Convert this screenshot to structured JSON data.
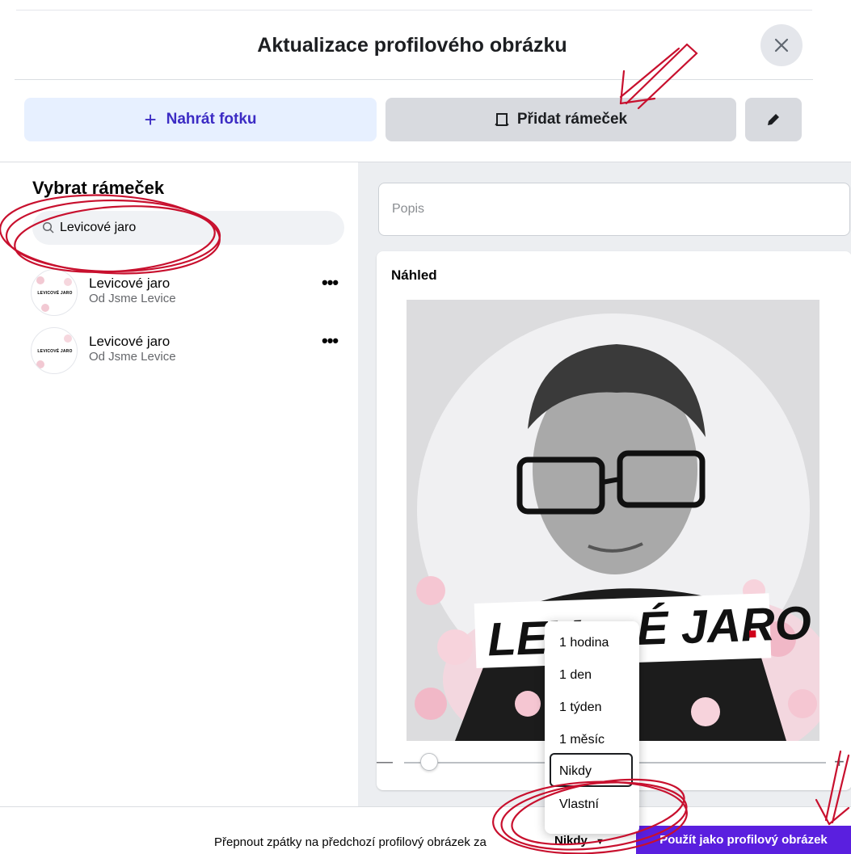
{
  "dialog": {
    "title": "Aktualizace profilového obrázku",
    "close_icon": "close-icon"
  },
  "tabs": {
    "upload_label": "Nahrát fotku",
    "upload_icon": "plus-icon",
    "frame_label": "Přidat rámeček",
    "frame_icon": "frame-icon",
    "edit_icon": "pencil-icon"
  },
  "frames_panel": {
    "title": "Vybrat rámeček",
    "search": {
      "value": "Levicové jaro",
      "icon": "search-icon"
    },
    "items": [
      {
        "name": "Levicové jaro",
        "source": "Od Jsme Levice",
        "thumb_text": "LEVICOVÉ JARO",
        "more_label": "•••"
      },
      {
        "name": "Levicové jaro",
        "source": "Od Jsme Levice",
        "thumb_text": "LEVICOVÉ JARO",
        "more_label": "•••"
      }
    ]
  },
  "editor": {
    "caption_placeholder": "Popis",
    "preview_label": "Náhled",
    "frame_banner_left": "LEV",
    "frame_banner_right": "É JARO",
    "frame_banner_dot": ".",
    "zoom": {
      "minus": "—",
      "plus": "+",
      "level": 0.04
    }
  },
  "revert_menu": {
    "options": [
      "1 hodina",
      "1 den",
      "1 týden",
      "1 měsíc",
      "Nikdy",
      "Vlastní"
    ],
    "selected": "Nikdy"
  },
  "footer": {
    "revert_text": "Přepnout zpátky na předchozí profilový obrázek za",
    "revert_value": "Nikdy",
    "primary_button": "Použít jako profilový obrázek"
  },
  "colors": {
    "accent": "#5a1fdf",
    "upload_text": "#3c2cc4",
    "annotation": "#c8102e"
  }
}
